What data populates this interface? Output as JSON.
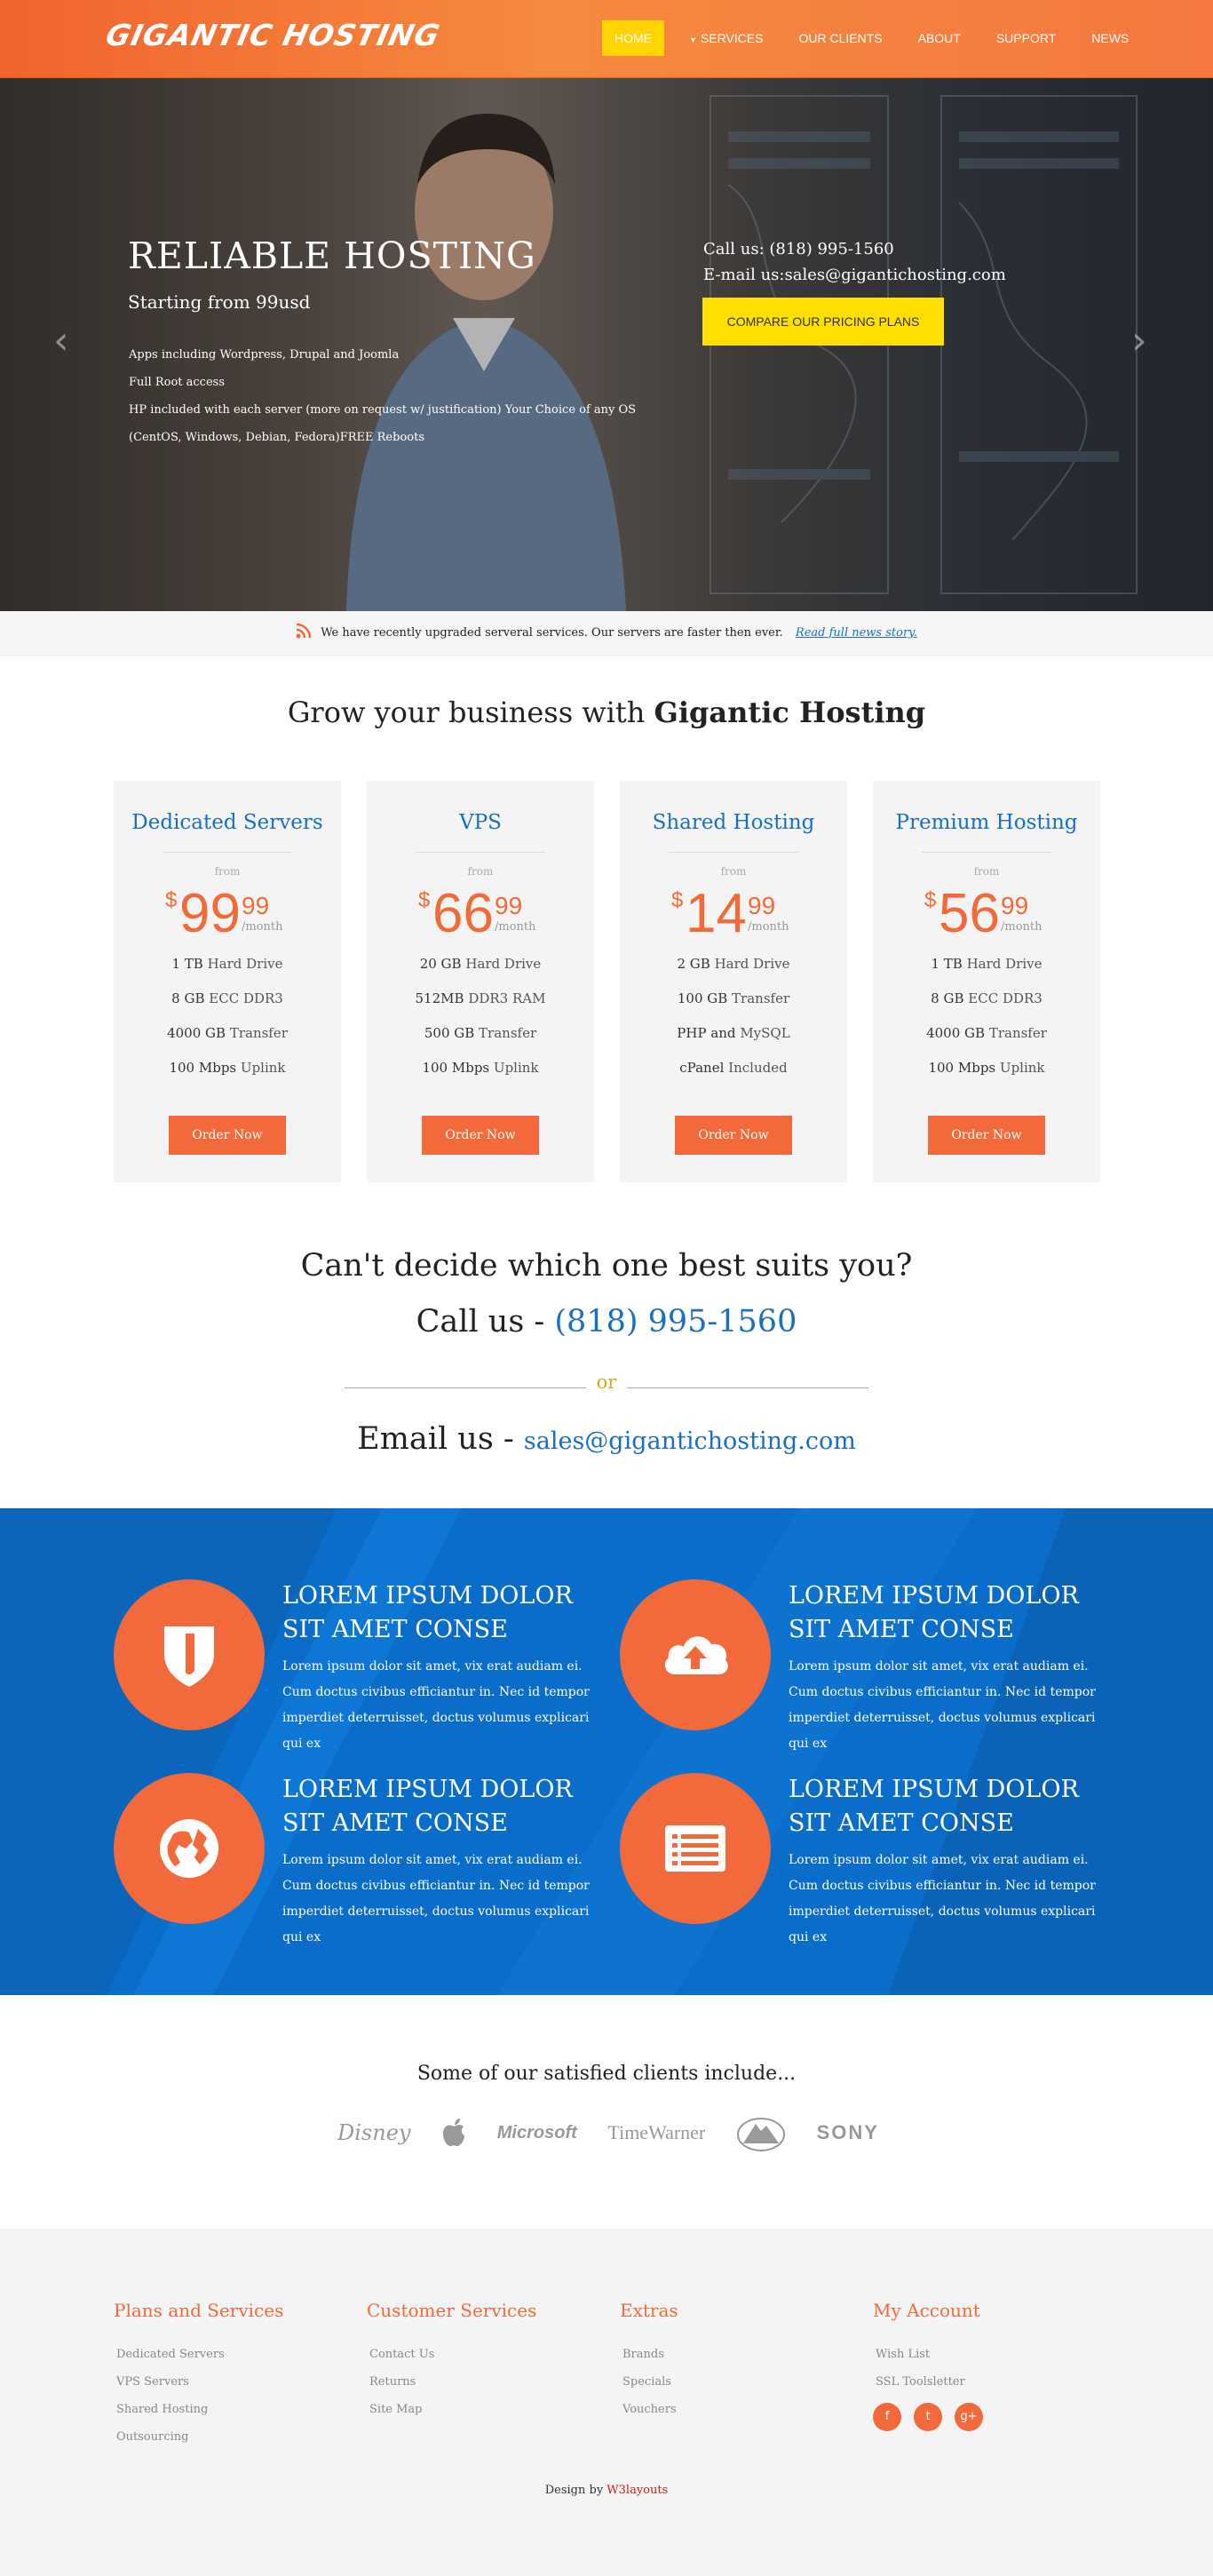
{
  "header": {
    "logo": "GIGANTIC HOSTING",
    "menu": [
      "HOME",
      "SERVICES",
      "OUR CLIENTS",
      "ABOUT",
      "SUPPORT",
      "NEWS"
    ]
  },
  "hero": {
    "title": "RELIABLE HOSTING",
    "subtitle": "Starting from 99usd",
    "features": [
      "Apps including Wordpress, Drupal and Joomla",
      "Full Root access",
      "HP included with each server (more on request w/ justification) Your Choice of any OS (CentOS, Windows, Debian, Fedora)FREE Reboots"
    ],
    "call": "Call us: (818) 995-1560",
    "email": "E-mail us:sales@gigantichosting.com",
    "button": "COMPARE OUR PRICING PLANS",
    "prev_icon": "chevron-left-icon",
    "next_icon": "chevron-right-icon"
  },
  "news": {
    "icon": "rss-icon",
    "text": "We have recently upgraded serveral services. Our servers are faster then ever.",
    "link": "Read full news story."
  },
  "grow": {
    "prefix": "Grow your business with ",
    "brand": "Gigantic Hosting"
  },
  "plans": [
    {
      "name": "Dedicated Servers",
      "from": "from",
      "currency": "$",
      "price": "99",
      "cents": "99",
      "period": "/month",
      "features": [
        {
          "bold": "1 TB",
          "text": "Hard Drive"
        },
        {
          "bold": "8 GB",
          "text": "ECC DDR3"
        },
        {
          "bold": "4000 GB",
          "text": "Transfer"
        },
        {
          "bold": "100 Mbps",
          "text": "Uplink"
        }
      ],
      "button": "Order Now"
    },
    {
      "name": "VPS",
      "from": "from",
      "currency": "$",
      "price": "66",
      "cents": "99",
      "period": "/month",
      "features": [
        {
          "bold": "20 GB",
          "text": "Hard Drive"
        },
        {
          "bold": "512MB",
          "text": "DDR3 RAM"
        },
        {
          "bold": "500 GB",
          "text": "Transfer"
        },
        {
          "bold": "100 Mbps",
          "text": "Uplink"
        }
      ],
      "button": "Order Now"
    },
    {
      "name": "Shared Hosting",
      "from": "from",
      "currency": "$",
      "price": "14",
      "cents": "99",
      "period": "/month",
      "features": [
        {
          "bold": "2 GB",
          "text": "Hard Drive"
        },
        {
          "bold": "100 GB",
          "text": "Transfer"
        },
        {
          "bold": "PHP and",
          "text": "MySQL"
        },
        {
          "bold": "cPanel",
          "text": "Included"
        }
      ],
      "button": "Order Now"
    },
    {
      "name": "Premium Hosting",
      "from": "from",
      "currency": "$",
      "price": "56",
      "cents": "99",
      "period": "/month",
      "features": [
        {
          "bold": "1 TB",
          "text": "Hard Drive"
        },
        {
          "bold": "8 GB",
          "text": "ECC DDR3"
        },
        {
          "bold": "4000 GB",
          "text": "Transfer"
        },
        {
          "bold": "100 Mbps",
          "text": "Uplink"
        }
      ],
      "button": "Order Now"
    }
  ],
  "cta": {
    "question": "Can't decide which one best suits you?",
    "call_prefix": "Call us - ",
    "phone": "(818) 995-1560",
    "or": "or",
    "email_prefix": "Email us - ",
    "email": "sales@gigantichosting.com"
  },
  "features": [
    {
      "icon": "shield-icon",
      "title": "LOREM IPSUM DOLOR SIT AMET CONSE",
      "text": "Lorem ipsum dolor sit amet, vix erat audiam ei. Cum doctus civibus efficiantur in. Nec id tempor imperdiet deterruisset, doctus volumus explicari qui ex"
    },
    {
      "icon": "cloud-upload-icon",
      "title": "LOREM IPSUM DOLOR SIT AMET CONSE",
      "text": "Lorem ipsum dolor sit amet, vix erat audiam ei. Cum doctus civibus efficiantur in. Nec id tempor imperdiet deterruisset, doctus volumus explicari qui ex"
    },
    {
      "icon": "globe-icon",
      "title": "LOREM IPSUM DOLOR SIT AMET CONSE",
      "text": "Lorem ipsum dolor sit amet, vix erat audiam ei. Cum doctus civibus efficiantur in. Nec id tempor imperdiet deterruisset, doctus volumus explicari qui ex"
    },
    {
      "icon": "list-icon",
      "title": "LOREM IPSUM DOLOR SIT AMET CONSE",
      "text": "Lorem ipsum dolor sit amet, vix erat audiam ei. Cum doctus civibus efficiantur in. Nec id tempor imperdiet deterruisset, doctus volumus explicari qui ex"
    }
  ],
  "clients": {
    "title": "Some of our satisfied clients include...",
    "logos": [
      "Disney",
      "Apple",
      "Microsoft",
      "TimeWarner",
      "Paramount",
      "SONY"
    ]
  },
  "footer": {
    "columns": [
      {
        "title": "Plans and Services",
        "items": [
          "Dedicated Servers",
          "VPS Servers",
          "Shared Hosting",
          "Outsourcing"
        ]
      },
      {
        "title": "Customer Services",
        "items": [
          "Contact Us",
          "Returns",
          "Site Map"
        ]
      },
      {
        "title": "Extras",
        "items": [
          "Brands",
          "Specials",
          "Vouchers"
        ]
      },
      {
        "title": "My Account",
        "items": [
          "Wish List",
          "SSL Toolsletter"
        ]
      }
    ],
    "social": [
      "facebook-icon",
      "twitter-icon",
      "google-plus-icon"
    ],
    "design_prefix": "Design by ",
    "design_link": "W3layouts"
  },
  "colors": {
    "orange": "#f26a3c",
    "yellow": "#ffdf00",
    "blue": "#0a6dc9",
    "link_blue": "#1a6fc0"
  }
}
